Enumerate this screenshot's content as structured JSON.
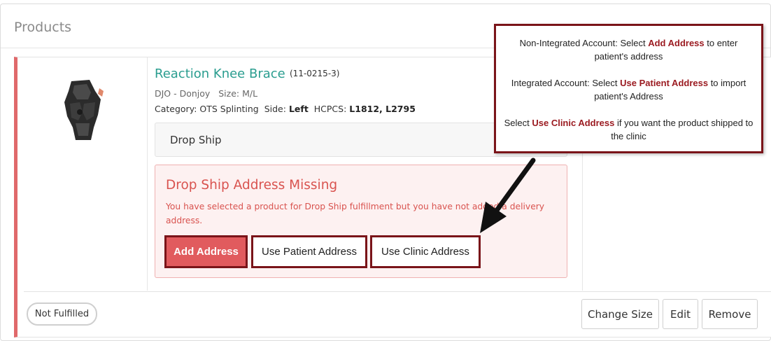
{
  "panel": {
    "title": "Products"
  },
  "product": {
    "name": "Reaction Knee Brace",
    "sku": "(11-0215-3)",
    "brand": "DJO - Donjoy",
    "size_label": "Size:",
    "size": "M/L",
    "category_label": "Category:",
    "category": "OTS Splinting",
    "side_label": "Side:",
    "side": "Left",
    "hcpcs_label": "HCPCS:",
    "hcpcs": "L1812, L2795",
    "image_icon": "knee-brace-image"
  },
  "fulfillment": {
    "method": "Drop Ship"
  },
  "alert": {
    "title": "Drop Ship Address Missing",
    "message": "You have selected a product for Drop Ship fulfillment but you have not added a delivery address."
  },
  "address_buttons": {
    "add": "Add Address",
    "patient": "Use Patient Address",
    "clinic": "Use Clinic Address"
  },
  "status_badge": "Not Fulfilled",
  "footer_buttons": {
    "change_size": "Change Size",
    "edit": "Edit",
    "remove": "Remove"
  },
  "callout": {
    "line1_pre": "Non-Integrated Account: Select ",
    "line1_hl": "Add Address",
    "line1_post": " to enter patient's address",
    "line2_pre": "Integrated Account: Select ",
    "line2_hl": "Use Patient Address",
    "line2_post": " to import patient's Address",
    "line3_pre": "Select ",
    "line3_hl": "Use Clinic Address",
    "line3_post": " if you want the product shipped to the clinic"
  },
  "colors": {
    "accent_red": "#e0696b",
    "highlight_border": "#7a1419",
    "product_name": "#2a9d8f",
    "alert_text": "#d9534f"
  }
}
